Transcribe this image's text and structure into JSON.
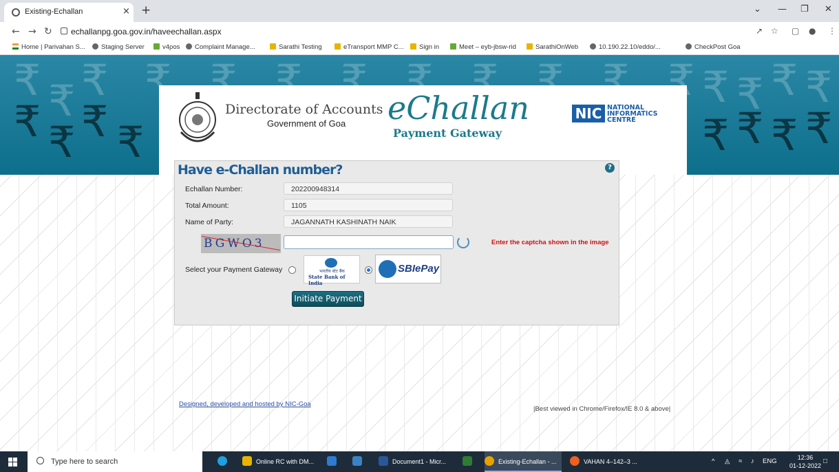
{
  "browser": {
    "tab_title": "Existing-Echallan",
    "tab_close": "×",
    "new_tab": "+",
    "url": "echallanpg.goa.gov.in/haveechallan.aspx",
    "bookmarks": [
      "Home | Parivahan S...",
      "Staging Server",
      "v4pos",
      "Complaint Manage...",
      "Sarathi Testing",
      "eTransport MMP C...",
      "Sign in",
      "Meet – eyb-jbsw-rid",
      "SarathiOnWeb",
      "10.190.22.10/eddo/...",
      "CheckPost Goa"
    ]
  },
  "header": {
    "dept": "Directorate of Accounts",
    "govt": "Government of Goa",
    "app_name": "eChallan",
    "app_sub": "Payment Gateway",
    "nic_logo": "NIC",
    "nic_line1": "NATIONAL",
    "nic_line2": "INFORMATICS",
    "nic_line3": "CENTRE"
  },
  "form": {
    "title": "Have e-Challan number?",
    "help": "?",
    "echallan_label": "Echallan Number:",
    "echallan_value": "202200948314",
    "amount_label": "Total Amount:",
    "amount_value": "1105",
    "party_label": "Name of Party:",
    "party_value": "JAGANNATH KASHINATH NAIK",
    "captcha_text": "BGWO3",
    "captcha_hint": "Enter the captcha shown in the image",
    "gateway_label": "Select your Payment Gateway",
    "sbi_hindi": "भारतीय स्टेट बैंक",
    "sbi_name": "State Bank of India",
    "sbipay_name": "SBIePay",
    "sbipay_selected": true,
    "pay_button": "Initiate Payment"
  },
  "footer": {
    "left": "Designed, developed and hosted by NIC-Goa",
    "right": "|Best viewed in Chrome/Firefox/IE 8.0 & above|"
  },
  "taskbar": {
    "search_placeholder": "Type here to search",
    "items": [
      "Online RC with DM...",
      "Document1 - Micr...",
      "Existing-Echallan - ...",
      "VAHAN 4–142–3 ..."
    ],
    "lang": "ENG",
    "time": "12:36",
    "date": "01-12-2022"
  }
}
